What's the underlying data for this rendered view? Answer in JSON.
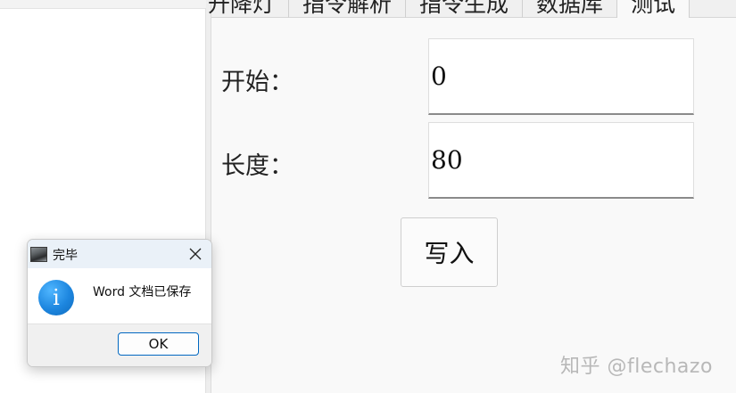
{
  "tabs": [
    {
      "label": "升降灯"
    },
    {
      "label": "指令解析"
    },
    {
      "label": "指令生成"
    },
    {
      "label": "数据库"
    },
    {
      "label": "测试"
    }
  ],
  "form": {
    "start_label": "开始：",
    "start_value": "0",
    "length_label": "长度：",
    "length_value": "80",
    "write_button": "写入"
  },
  "dialog": {
    "title": "完毕",
    "message": "Word 文档已保存",
    "ok_label": "OK",
    "icon": "info-icon"
  },
  "watermark": "知乎 @flechazo",
  "colors": {
    "dialog_button_border": "#0067c0",
    "info_icon": "#1d86df"
  }
}
